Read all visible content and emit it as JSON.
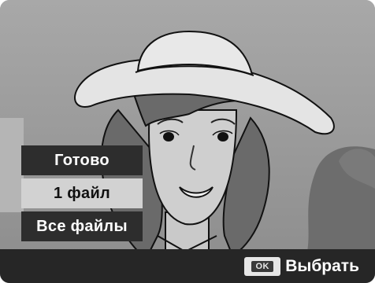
{
  "menu": {
    "items": [
      {
        "label": "Готово"
      },
      {
        "label": "1 файл"
      },
      {
        "label": "Все файлы"
      }
    ]
  },
  "bottom_bar": {
    "key_label": "OK",
    "action_label": "Выбрать"
  },
  "colors": {
    "menu_dark": "#2d2d2d",
    "menu_light": "#d2d2d2",
    "bar": "#262626"
  },
  "background_image": {
    "icon": "portrait-photo"
  }
}
